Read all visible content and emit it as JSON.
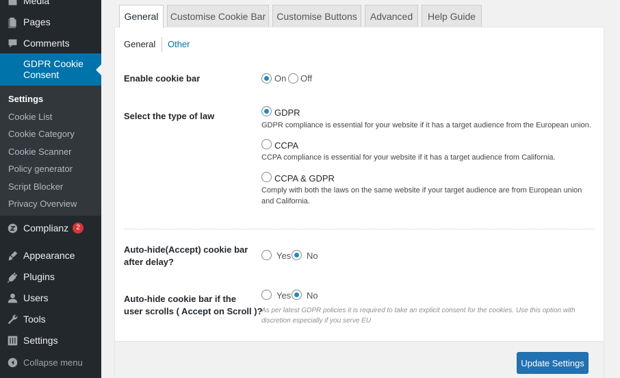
{
  "sidebar": {
    "media_label": "Media",
    "pages_label": "Pages",
    "comments_label": "Comments",
    "gdpr_label": "GDPR Cookie Consent",
    "submenu": [
      "Settings",
      "Cookie List",
      "Cookie Category",
      "Cookie Scanner",
      "Policy generator",
      "Script Blocker",
      "Privacy Overview"
    ],
    "complianz_label": "Complianz",
    "complianz_badge": "2",
    "appearance_label": "Appearance",
    "plugins_label": "Plugins",
    "users_label": "Users",
    "tools_label": "Tools",
    "settings_label": "Settings",
    "collapse_label": "Collapse menu"
  },
  "tabs": [
    "General",
    "Customise Cookie Bar",
    "Customise Buttons",
    "Advanced",
    "Help Guide"
  ],
  "subtabs": {
    "general": "General",
    "other": "Other"
  },
  "enable_bar": {
    "label": "Enable cookie bar",
    "on": "On",
    "off": "Off",
    "selected": "On"
  },
  "law": {
    "label": "Select the type of law",
    "selected": "GDPR",
    "options": [
      {
        "name": "GDPR",
        "desc": "GDPR compliance is essential for your website if it has a target audience from the European union."
      },
      {
        "name": "CCPA",
        "desc": "CCPA compliance is essential for your website if it has a target audience from California."
      },
      {
        "name": "CCPA & GDPR",
        "desc1": "Comply with both the laws on the same website if your target audience are from European union",
        "desc2": "and California."
      }
    ]
  },
  "autohide_delay": {
    "label1": "Auto-hide(Accept) cookie bar",
    "label2": "after delay?",
    "yes": "Yes",
    "no": "No",
    "selected": "No"
  },
  "autohide_scroll": {
    "label1": "Auto-hide cookie bar if the",
    "label2": "user scrolls ( Accept on Scroll )?",
    "yes": "Yes",
    "no": "No",
    "selected": "No",
    "hint1": "As per latest GDPR policies it is required to take an explicit consent for the cookies. Use this option with",
    "hint2": "discretion especially if you serve EU"
  },
  "update_button": "Update Settings",
  "colors": {
    "sidebar": "#23282d",
    "active": "#0073aa",
    "submenu": "#32373c",
    "button": "#2271b1",
    "badge": "#d63638"
  }
}
